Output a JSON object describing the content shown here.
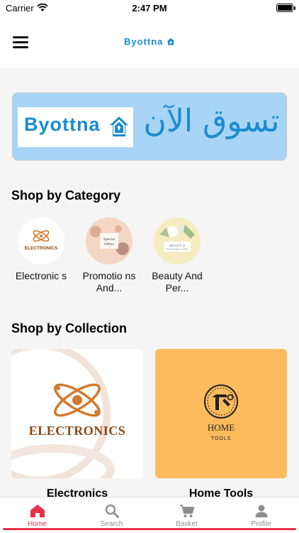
{
  "status": {
    "carrier": "Carrier",
    "time": "2:47 PM"
  },
  "nav": {
    "brand": "Byottna"
  },
  "banner": {
    "brand": "Byottna",
    "arabic": "تسوق الآن"
  },
  "sections": {
    "category_title": "Shop by Category",
    "collection_title": "Shop by Collection"
  },
  "categories": [
    {
      "label": "Electronic s",
      "circle_text": "ELECTRONICS"
    },
    {
      "label": "Promotio ns And...",
      "circle_text": "Special Offers"
    },
    {
      "label": "Beauty And Per...",
      "circle_text": "BEAUTY & PERSONAL CARE"
    }
  ],
  "collections": [
    {
      "label": "Electronics",
      "image_text": "ELECTRONICS",
      "bg": "#ffffff"
    },
    {
      "label": "Home Tools",
      "image_text": "HOME",
      "image_sub": "TOOLS",
      "bg": "#fcbb5d"
    }
  ],
  "tabs": [
    {
      "label": "Home",
      "icon": "home-icon",
      "active": true
    },
    {
      "label": "Search",
      "icon": "search-icon",
      "active": false
    },
    {
      "label": "Basket",
      "icon": "basket-icon",
      "active": false
    },
    {
      "label": "Profile",
      "icon": "profile-icon",
      "active": false
    }
  ],
  "colors": {
    "brand": "#1a8ccf",
    "accent": "#e8324b",
    "banner_bg": "#a8d4f5",
    "home_tools_bg": "#fcbb5d",
    "electronics_orange": "#d4782a"
  }
}
